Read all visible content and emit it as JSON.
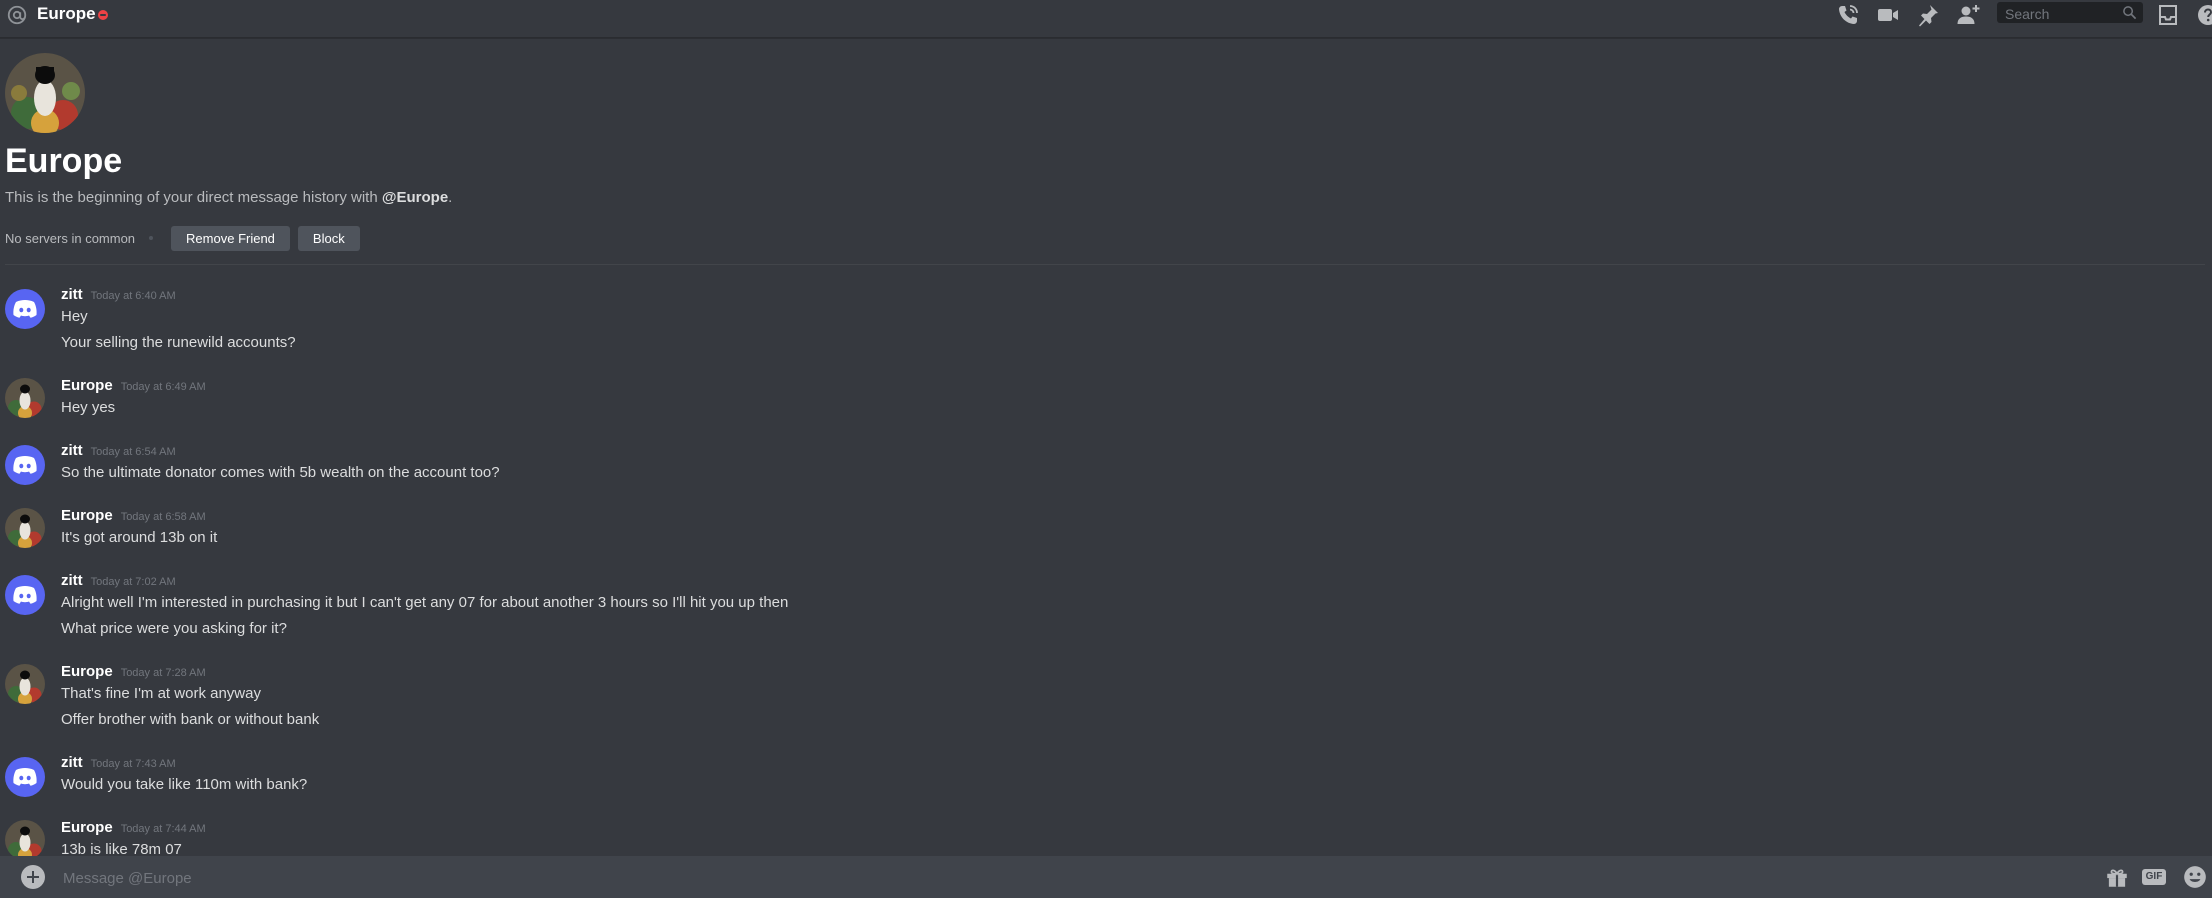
{
  "header": {
    "title": "Europe",
    "search_placeholder": "Search",
    "icons": [
      "at-icon",
      "dnd-status-icon",
      "call-icon",
      "video-icon",
      "pin-icon",
      "add-friend-icon",
      "search-icon",
      "inbox-icon",
      "help-icon"
    ]
  },
  "intro": {
    "name": "Europe",
    "description_prefix": "This is the beginning of your direct message history with ",
    "mention": "@Europe",
    "description_suffix": ".",
    "servers_text": "No servers in common",
    "remove_friend_label": "Remove Friend",
    "block_label": "Block"
  },
  "messages": [
    {
      "author": "zitt",
      "timestamp": "Today at 6:40 AM",
      "avatar": "discord",
      "lines": [
        "Hey",
        "Your selling the runewild accounts?"
      ]
    },
    {
      "author": "Europe",
      "timestamp": "Today at 6:49 AM",
      "avatar": "user",
      "lines": [
        "Hey yes"
      ]
    },
    {
      "author": "zitt",
      "timestamp": "Today at 6:54 AM",
      "avatar": "discord",
      "lines": [
        "So the ultimate donator comes with 5b wealth on the account too?"
      ]
    },
    {
      "author": "Europe",
      "timestamp": "Today at 6:58 AM",
      "avatar": "user",
      "lines": [
        "It's got around 13b on it"
      ]
    },
    {
      "author": "zitt",
      "timestamp": "Today at 7:02 AM",
      "avatar": "discord",
      "lines": [
        "Alright well I'm interested in purchasing it but I can't get any 07 for about another 3 hours so I'll hit you up then",
        "What price were you asking for it?"
      ]
    },
    {
      "author": "Europe",
      "timestamp": "Today at 7:28 AM",
      "avatar": "user",
      "lines": [
        "That's fine I'm at work anyway",
        "Offer brother with bank or without bank"
      ]
    },
    {
      "author": "zitt",
      "timestamp": "Today at 7:43 AM",
      "avatar": "discord",
      "lines": [
        "Would you take like 110m with bank?"
      ]
    },
    {
      "author": "Europe",
      "timestamp": "Today at 7:44 AM",
      "avatar": "user",
      "lines": [
        "13b is like 78m 07"
      ]
    }
  ],
  "composer": {
    "placeholder": "Message @Europe",
    "gif_label": "GIF"
  },
  "colors": {
    "background": "#36393f",
    "composer": "#40444b",
    "blurple": "#5865f2",
    "dnd": "#ed4245"
  }
}
